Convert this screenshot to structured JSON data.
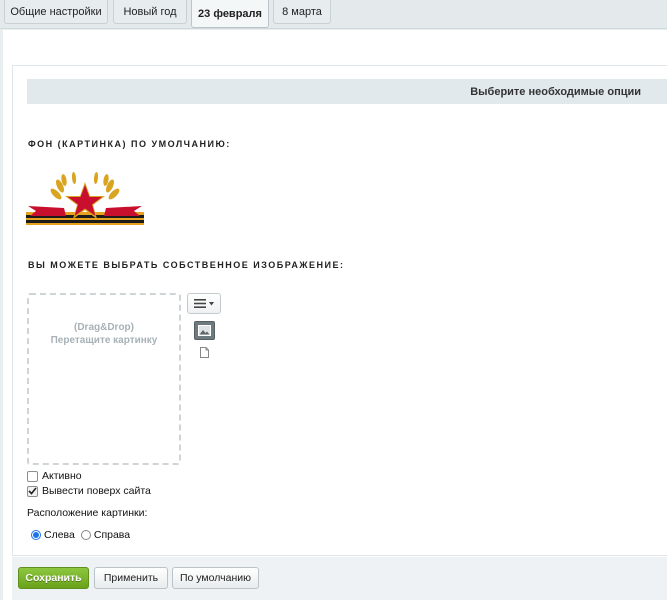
{
  "tabs": [
    {
      "label": "Общие настройки",
      "active": false
    },
    {
      "label": "Новый год",
      "active": false
    },
    {
      "label": "23 февраля",
      "active": true
    },
    {
      "label": "8 марта",
      "active": false
    }
  ],
  "options_bar": "Выберите необходимые опции",
  "default_bg_title": "ФОН (КАРТИНКА) ПО УМОЛЧАНИЮ:",
  "custom_image_title": "ВЫ МОЖЕТЕ ВЫБРАТЬ СОБСТВЕННОЕ ИЗОБРАЖЕНИЕ:",
  "dropzone": {
    "line1": "(Drag&Drop)",
    "line2": "Перетащите картинку"
  },
  "checkboxes": [
    {
      "label": "Активно",
      "checked": false
    },
    {
      "label": "Вывести поверх сайта",
      "checked": true
    }
  ],
  "position": {
    "label": "Расположение картинки:",
    "options": [
      {
        "label": "Слева",
        "selected": true
      },
      {
        "label": "Справа",
        "selected": false
      }
    ]
  },
  "buttons": {
    "save": "Сохранить",
    "apply": "Применить",
    "default": "По умолчанию"
  },
  "colors": {
    "save_green": "#7cb52e",
    "radio_blue": "#1a73e8",
    "ribbon_red": "#c8102e",
    "gold": "#d9a521"
  },
  "icons": [
    "menu-icon",
    "image-icon",
    "file-icon",
    "check-icon",
    "star-emblem"
  ]
}
